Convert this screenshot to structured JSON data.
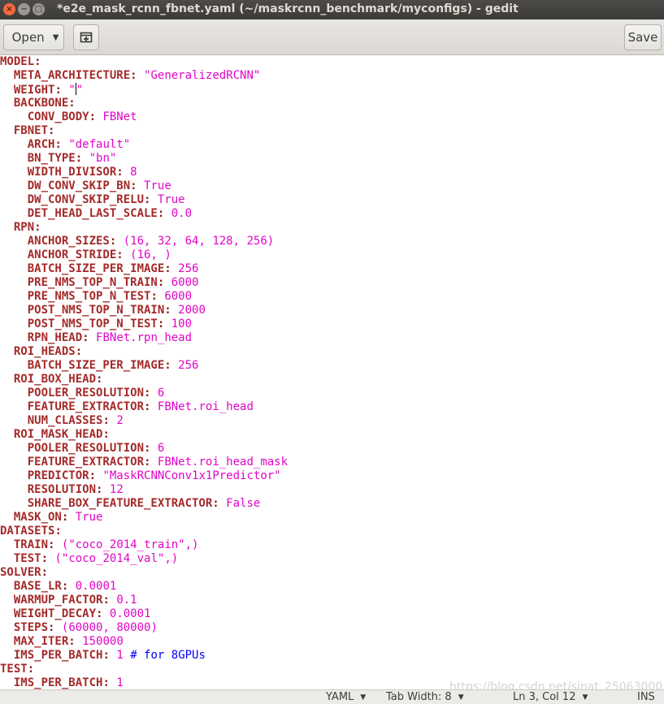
{
  "window": {
    "title": "*e2e_mask_rcnn_fbnet.yaml (~/maskrcnn_benchmark/myconfigs) - gedit",
    "close_glyph": "×",
    "minimize_glyph": "−",
    "maximize_glyph": "□"
  },
  "header": {
    "open_label": "Open",
    "save_label": "Save",
    "new_tab_icon": "new-document-tab-icon"
  },
  "editor": {
    "lines": [
      [
        [
          "k",
          "MODEL"
        ],
        [
          "p",
          ":"
        ]
      ],
      [
        [
          "t",
          "  "
        ],
        [
          "k",
          "META_ARCHITECTURE"
        ],
        [
          "p",
          ":"
        ],
        [
          "t",
          " "
        ],
        [
          "v",
          "\"GeneralizedRCNN\""
        ]
      ],
      [
        [
          "t",
          "  "
        ],
        [
          "k",
          "WEIGHT"
        ],
        [
          "p",
          ":"
        ],
        [
          "t",
          " "
        ],
        [
          "v",
          "\""
        ],
        [
          "cursor",
          ""
        ],
        [
          "v",
          "\""
        ]
      ],
      [
        [
          "t",
          "  "
        ],
        [
          "k",
          "BACKBONE"
        ],
        [
          "p",
          ":"
        ]
      ],
      [
        [
          "t",
          "    "
        ],
        [
          "k",
          "CONV_BODY"
        ],
        [
          "p",
          ":"
        ],
        [
          "t",
          " "
        ],
        [
          "v",
          "FBNet"
        ]
      ],
      [
        [
          "t",
          "  "
        ],
        [
          "k",
          "FBNET"
        ],
        [
          "p",
          ":"
        ]
      ],
      [
        [
          "t",
          "    "
        ],
        [
          "k",
          "ARCH"
        ],
        [
          "p",
          ":"
        ],
        [
          "t",
          " "
        ],
        [
          "v",
          "\"default\""
        ]
      ],
      [
        [
          "t",
          "    "
        ],
        [
          "k",
          "BN_TYPE"
        ],
        [
          "p",
          ":"
        ],
        [
          "t",
          " "
        ],
        [
          "v",
          "\"bn\""
        ]
      ],
      [
        [
          "t",
          "    "
        ],
        [
          "k",
          "WIDTH_DIVISOR"
        ],
        [
          "p",
          ":"
        ],
        [
          "t",
          " "
        ],
        [
          "v",
          "8"
        ]
      ],
      [
        [
          "t",
          "    "
        ],
        [
          "k",
          "DW_CONV_SKIP_BN"
        ],
        [
          "p",
          ":"
        ],
        [
          "t",
          " "
        ],
        [
          "v",
          "True"
        ]
      ],
      [
        [
          "t",
          "    "
        ],
        [
          "k",
          "DW_CONV_SKIP_RELU"
        ],
        [
          "p",
          ":"
        ],
        [
          "t",
          " "
        ],
        [
          "v",
          "True"
        ]
      ],
      [
        [
          "t",
          "    "
        ],
        [
          "k",
          "DET_HEAD_LAST_SCALE"
        ],
        [
          "p",
          ":"
        ],
        [
          "t",
          " "
        ],
        [
          "v",
          "0.0"
        ]
      ],
      [
        [
          "t",
          "  "
        ],
        [
          "k",
          "RPN"
        ],
        [
          "p",
          ":"
        ]
      ],
      [
        [
          "t",
          "    "
        ],
        [
          "k",
          "ANCHOR_SIZES"
        ],
        [
          "p",
          ":"
        ],
        [
          "t",
          " "
        ],
        [
          "v",
          "(16, 32, 64, 128, 256)"
        ]
      ],
      [
        [
          "t",
          "    "
        ],
        [
          "k",
          "ANCHOR_STRIDE"
        ],
        [
          "p",
          ":"
        ],
        [
          "t",
          " "
        ],
        [
          "v",
          "(16, )"
        ]
      ],
      [
        [
          "t",
          "    "
        ],
        [
          "k",
          "BATCH_SIZE_PER_IMAGE"
        ],
        [
          "p",
          ":"
        ],
        [
          "t",
          " "
        ],
        [
          "v",
          "256"
        ]
      ],
      [
        [
          "t",
          "    "
        ],
        [
          "k",
          "PRE_NMS_TOP_N_TRAIN"
        ],
        [
          "p",
          ":"
        ],
        [
          "t",
          " "
        ],
        [
          "v",
          "6000"
        ]
      ],
      [
        [
          "t",
          "    "
        ],
        [
          "k",
          "PRE_NMS_TOP_N_TEST"
        ],
        [
          "p",
          ":"
        ],
        [
          "t",
          " "
        ],
        [
          "v",
          "6000"
        ]
      ],
      [
        [
          "t",
          "    "
        ],
        [
          "k",
          "POST_NMS_TOP_N_TRAIN"
        ],
        [
          "p",
          ":"
        ],
        [
          "t",
          " "
        ],
        [
          "v",
          "2000"
        ]
      ],
      [
        [
          "t",
          "    "
        ],
        [
          "k",
          "POST_NMS_TOP_N_TEST"
        ],
        [
          "p",
          ":"
        ],
        [
          "t",
          " "
        ],
        [
          "v",
          "100"
        ]
      ],
      [
        [
          "t",
          "    "
        ],
        [
          "k",
          "RPN_HEAD"
        ],
        [
          "p",
          ":"
        ],
        [
          "t",
          " "
        ],
        [
          "v",
          "FBNet.rpn_head"
        ]
      ],
      [
        [
          "t",
          "  "
        ],
        [
          "k",
          "ROI_HEADS"
        ],
        [
          "p",
          ":"
        ]
      ],
      [
        [
          "t",
          "    "
        ],
        [
          "k",
          "BATCH_SIZE_PER_IMAGE"
        ],
        [
          "p",
          ":"
        ],
        [
          "t",
          " "
        ],
        [
          "v",
          "256"
        ]
      ],
      [
        [
          "t",
          "  "
        ],
        [
          "k",
          "ROI_BOX_HEAD"
        ],
        [
          "p",
          ":"
        ]
      ],
      [
        [
          "t",
          "    "
        ],
        [
          "k",
          "POOLER_RESOLUTION"
        ],
        [
          "p",
          ":"
        ],
        [
          "t",
          " "
        ],
        [
          "v",
          "6"
        ]
      ],
      [
        [
          "t",
          "    "
        ],
        [
          "k",
          "FEATURE_EXTRACTOR"
        ],
        [
          "p",
          ":"
        ],
        [
          "t",
          " "
        ],
        [
          "v",
          "FBNet.roi_head"
        ]
      ],
      [
        [
          "t",
          "    "
        ],
        [
          "k",
          "NUM_CLASSES"
        ],
        [
          "p",
          ":"
        ],
        [
          "t",
          " "
        ],
        [
          "v",
          "2"
        ]
      ],
      [
        [
          "t",
          "  "
        ],
        [
          "k",
          "ROI_MASK_HEAD"
        ],
        [
          "p",
          ":"
        ]
      ],
      [
        [
          "t",
          "    "
        ],
        [
          "k",
          "POOLER_RESOLUTION"
        ],
        [
          "p",
          ":"
        ],
        [
          "t",
          " "
        ],
        [
          "v",
          "6"
        ]
      ],
      [
        [
          "t",
          "    "
        ],
        [
          "k",
          "FEATURE_EXTRACTOR"
        ],
        [
          "p",
          ":"
        ],
        [
          "t",
          " "
        ],
        [
          "v",
          "FBNet.roi_head_mask"
        ]
      ],
      [
        [
          "t",
          "    "
        ],
        [
          "k",
          "PREDICTOR"
        ],
        [
          "p",
          ":"
        ],
        [
          "t",
          " "
        ],
        [
          "v",
          "\"MaskRCNNConv1x1Predictor\""
        ]
      ],
      [
        [
          "t",
          "    "
        ],
        [
          "k",
          "RESOLUTION"
        ],
        [
          "p",
          ":"
        ],
        [
          "t",
          " "
        ],
        [
          "v",
          "12"
        ]
      ],
      [
        [
          "t",
          "    "
        ],
        [
          "k",
          "SHARE_BOX_FEATURE_EXTRACTOR"
        ],
        [
          "p",
          ":"
        ],
        [
          "t",
          " "
        ],
        [
          "v",
          "False"
        ]
      ],
      [
        [
          "t",
          "  "
        ],
        [
          "k",
          "MASK_ON"
        ],
        [
          "p",
          ":"
        ],
        [
          "t",
          " "
        ],
        [
          "v",
          "True"
        ]
      ],
      [
        [
          "k",
          "DATASETS"
        ],
        [
          "p",
          ":"
        ]
      ],
      [
        [
          "t",
          "  "
        ],
        [
          "k",
          "TRAIN"
        ],
        [
          "p",
          ":"
        ],
        [
          "t",
          " "
        ],
        [
          "v",
          "(\"coco_2014_train\",)"
        ]
      ],
      [
        [
          "t",
          "  "
        ],
        [
          "k",
          "TEST"
        ],
        [
          "p",
          ":"
        ],
        [
          "t",
          " "
        ],
        [
          "v",
          "(\"coco_2014_val\",)"
        ]
      ],
      [
        [
          "k",
          "SOLVER"
        ],
        [
          "p",
          ":"
        ]
      ],
      [
        [
          "t",
          "  "
        ],
        [
          "k",
          "BASE_LR"
        ],
        [
          "p",
          ":"
        ],
        [
          "t",
          " "
        ],
        [
          "v",
          "0.0001"
        ]
      ],
      [
        [
          "t",
          "  "
        ],
        [
          "k",
          "WARMUP_FACTOR"
        ],
        [
          "p",
          ":"
        ],
        [
          "t",
          " "
        ],
        [
          "v",
          "0.1"
        ]
      ],
      [
        [
          "t",
          "  "
        ],
        [
          "k",
          "WEIGHT_DECAY"
        ],
        [
          "p",
          ":"
        ],
        [
          "t",
          " "
        ],
        [
          "v",
          "0.0001"
        ]
      ],
      [
        [
          "t",
          "  "
        ],
        [
          "k",
          "STEPS"
        ],
        [
          "p",
          ":"
        ],
        [
          "t",
          " "
        ],
        [
          "v",
          "(60000, 80000)"
        ]
      ],
      [
        [
          "t",
          "  "
        ],
        [
          "k",
          "MAX_ITER"
        ],
        [
          "p",
          ":"
        ],
        [
          "t",
          " "
        ],
        [
          "v",
          "150000"
        ]
      ],
      [
        [
          "t",
          "  "
        ],
        [
          "k",
          "IMS_PER_BATCH"
        ],
        [
          "p",
          ":"
        ],
        [
          "t",
          " "
        ],
        [
          "v",
          "1"
        ],
        [
          "t",
          " "
        ],
        [
          "c",
          "# for 8GPUs"
        ]
      ],
      [
        [
          "k",
          "TEST"
        ],
        [
          "p",
          ":"
        ]
      ],
      [
        [
          "t",
          "  "
        ],
        [
          "k",
          "IMS_PER_BATCH"
        ],
        [
          "p",
          ":"
        ],
        [
          "t",
          " "
        ],
        [
          "v",
          "1"
        ]
      ]
    ],
    "watermark": "https://blog.csdn.net/sinat_25063000"
  },
  "statusbar": {
    "language": "YAML",
    "tab_width": "Tab Width: 8",
    "position": "Ln 3, Col 12",
    "mode": "INS"
  },
  "colors": {
    "keyword": "#a52a2a",
    "value": "#e005c8",
    "comment": "#0000ff",
    "titlebar": "#3c3b37",
    "close_button": "#f46a3f"
  }
}
